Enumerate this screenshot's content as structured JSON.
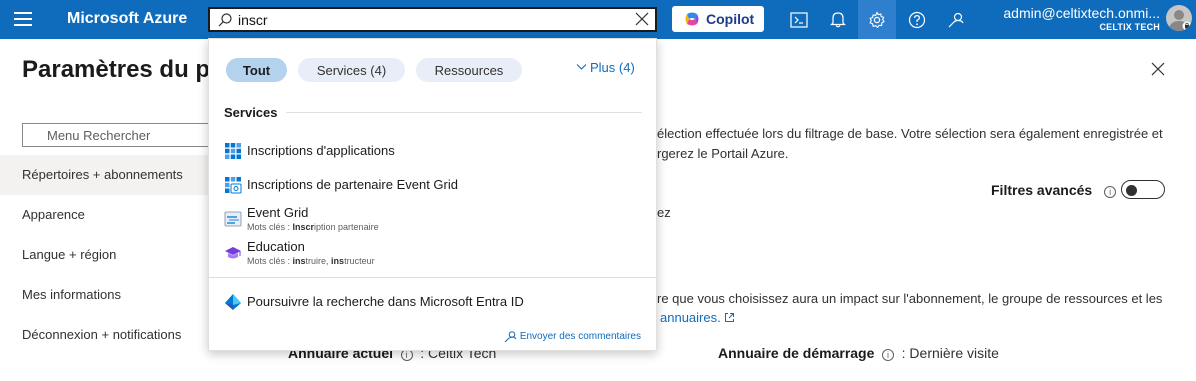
{
  "topbar": {
    "brand": "Microsoft Azure",
    "search_value": "inscr",
    "copilot_label": "Copilot",
    "account_email": "admin@celtixtech.onmi...",
    "account_tenant": "CELTIX TECH",
    "icons": [
      "menu-icon",
      "cloud-shell-icon",
      "notifications-icon",
      "settings-icon",
      "help-icon",
      "feedback-icon"
    ]
  },
  "page": {
    "title": "Paramètres du p",
    "menu_search_placeholder": "Menu Rechercher",
    "nav": [
      {
        "label": "Répertoires + abonnements",
        "selected": true
      },
      {
        "label": "Apparence",
        "selected": false
      },
      {
        "label": "Langue + région",
        "selected": false
      },
      {
        "label": "Mes informations",
        "selected": false
      },
      {
        "label": "Déconnexion + notifications",
        "selected": false
      }
    ],
    "content_line1": "élection effectuée lors du filtrage de base. Votre sélection sera également enregistrée et",
    "content_line2": "rgerez le Portail Azure.",
    "filters_label": "Filtres avancés",
    "content_line3": "ez",
    "content_line4": "re que vous choisissez aura un impact sur l'abonnement, le groupe de ressources et les",
    "content_link": "annuaires.",
    "current_dir_label": "Annuaire actuel",
    "current_dir_value": ": Celtix Tech",
    "startup_dir_label": "Annuaire de démarrage",
    "startup_dir_value": ": Dernière visite"
  },
  "dropdown": {
    "pills": [
      {
        "label": "Tout",
        "active": true
      },
      {
        "label": "Services  (4)",
        "active": false
      },
      {
        "label": "Ressources",
        "active": false
      }
    ],
    "more_label": "Plus (4)",
    "section_title": "Services",
    "results": [
      {
        "title": "Inscriptions d'applications",
        "icon": "app-registrations-icon"
      },
      {
        "title": "Inscriptions de partenaire Event Grid",
        "icon": "partner-registration-icon"
      },
      {
        "title": "Event Grid",
        "icon": "event-grid-icon",
        "sub_prefix": "Mots clés : ",
        "sub_bold": "Inscr",
        "sub_rest": "iption partenaire"
      },
      {
        "title": "Education",
        "icon": "education-icon",
        "sub_prefix": "Mots clés : ",
        "sub_bold": "ins",
        "sub_rest": "truire, ",
        "sub_bold2": "ins",
        "sub_rest2": "tructeur"
      }
    ],
    "entra_label": "Poursuivre la recherche dans Microsoft Entra ID",
    "feedback_label": "Envoyer des commentaires"
  },
  "colors": {
    "topbar": "#0f6cbd",
    "pill_active": "#b4d1ee",
    "pill": "#e8eef7",
    "link": "#0f6cbd"
  }
}
